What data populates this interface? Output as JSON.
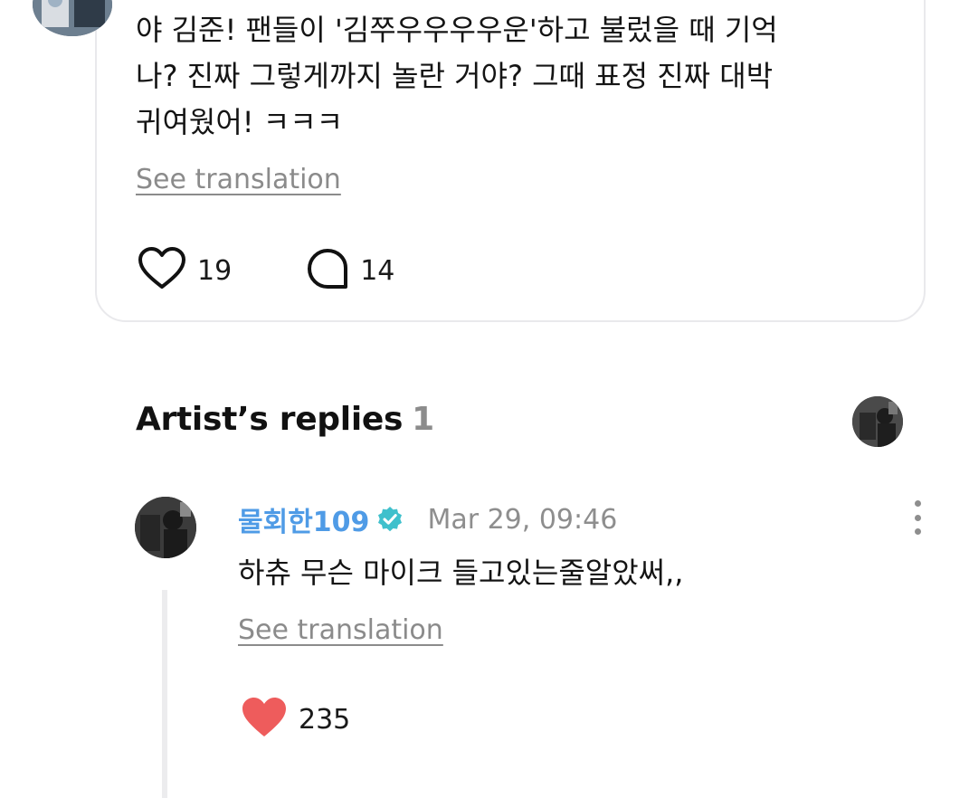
{
  "post": {
    "body": "야 김준! 팬들이 '김쭈우우우우운'하고 불렀을 때 기억\n나? 진짜 그렇게까지 놀란 거야? 그때 표정 진짜 대박\n귀여웠어! ㅋㅋㅋ",
    "see_translation": "See translation",
    "like_count": "19",
    "comment_count": "14",
    "icons": {
      "like": "heart-outline-icon",
      "comment": "speech-bubble-icon"
    }
  },
  "artist_replies": {
    "title": "Artist’s replies",
    "count": "1"
  },
  "reply": {
    "username": "물회한109",
    "timestamp": "Mar 29, 09:46",
    "body": "하츄 무슨 마이크 들고있는줄알았써,,",
    "see_translation": "See translation",
    "like_count": "235",
    "icons": {
      "verified": "verified-badge-icon",
      "more": "more-vertical-icon",
      "like": "heart-filled-icon"
    }
  },
  "colors": {
    "username": "#4f9be6",
    "verified_badge": "#3fc0cc",
    "liked_heart": "#ee5c5c",
    "muted_text": "#8e8e8e",
    "card_border": "#e9e9ec"
  }
}
